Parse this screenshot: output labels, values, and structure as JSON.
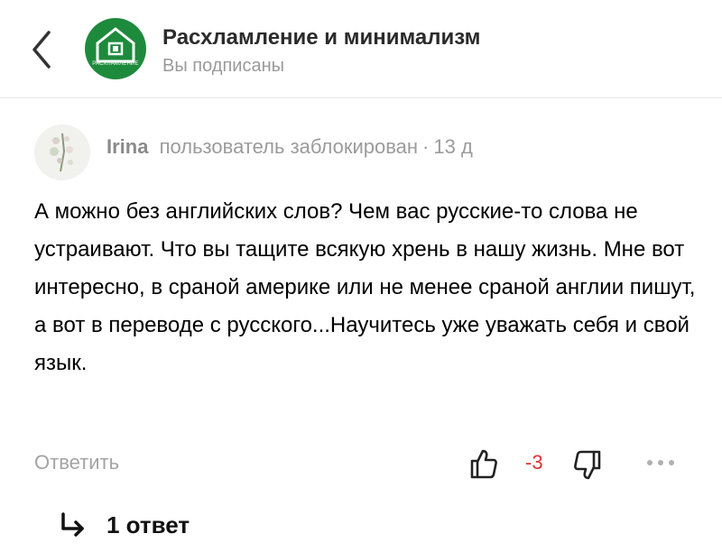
{
  "header": {
    "channel_name": "Расхламление и минимализм",
    "subscription_status": "Вы подписаны",
    "logo_text": "РАСХЛАМЛЕНИЕ"
  },
  "comment": {
    "author": "Irina",
    "status": "пользователь заблокирован",
    "separator": "·",
    "time_ago": "13 д",
    "text": "А можно без английских слов? Чем вас русские-то слова не устраивают. Что вы тащите всякую хрень в нашу жизнь. Мне вот интересно, в сраной америке или не менее сраной англии пишут, а вот в переводе с русского...Научитесь уже уважать себя и свой язык."
  },
  "actions": {
    "reply_label": "Ответить",
    "score": "-3",
    "colors": {
      "score": "#e0302f",
      "logo": "#1e8a3c"
    }
  },
  "replies": {
    "label": "1 ответ"
  },
  "icons": [
    "chevron-left-icon",
    "house-icon",
    "thumbs-up-icon",
    "thumbs-down-icon",
    "more-dots-icon",
    "reply-arrow-icon"
  ]
}
